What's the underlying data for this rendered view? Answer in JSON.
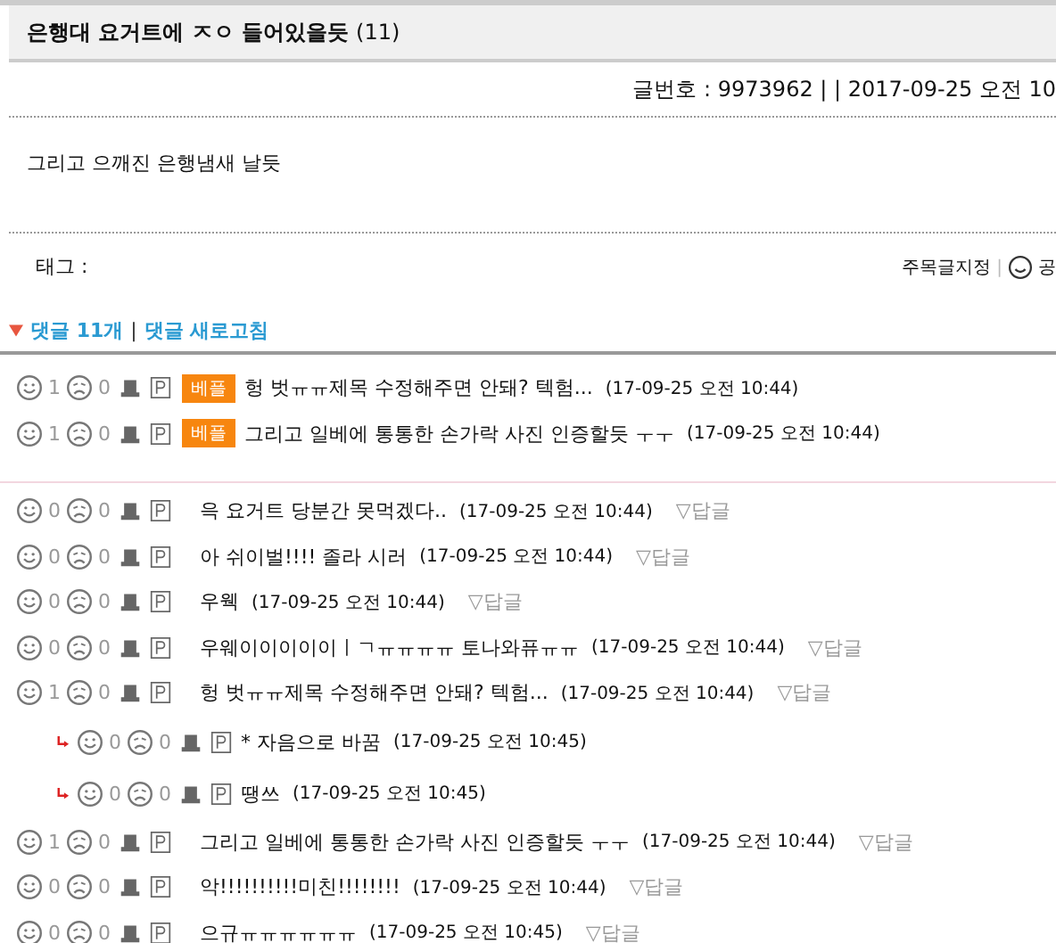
{
  "title": {
    "text": "은행대 요거트에 ㅈㅇ 들어있을듯",
    "count": "(11)"
  },
  "meta": "글번호 : 9973962 | | 2017-09-25 오전 10",
  "body": "그리고 으깨진 은행냄새 날듯",
  "tag_label": "태그 :",
  "actions": {
    "bookmark": "주목글지정",
    "separator": "|",
    "share": "공"
  },
  "comments_header": {
    "count_link": "댓글 11개",
    "separator": "|",
    "refresh_link": "댓글 새로고침"
  },
  "best_comments": [
    {
      "likes": "1",
      "dislikes": "0",
      "badge": "베플",
      "text": "헝 벗ㅠㅠ제목 수정해주면 안돼? 텍험...",
      "time": "(17-09-25 오전 10:44)"
    },
    {
      "likes": "1",
      "dislikes": "0",
      "badge": "베플",
      "text": "그리고 일베에 통통한 손가락 사진 인증할듯 ㅜㅜ",
      "time": "(17-09-25 오전 10:44)"
    }
  ],
  "comments": [
    {
      "likes": "0",
      "dislikes": "0",
      "text": "윽 요거트 당분간 못먹겠다..",
      "time": "(17-09-25 오전 10:44)",
      "reply_link": "▽답글"
    },
    {
      "likes": "0",
      "dislikes": "0",
      "text": "아 쉬이벌!!!! 졸라 시러",
      "time": "(17-09-25 오전 10:44)",
      "reply_link": "▽답글"
    },
    {
      "likes": "0",
      "dislikes": "0",
      "text": "우웩",
      "time": "(17-09-25 오전 10:44)",
      "reply_link": "▽답글"
    },
    {
      "likes": "0",
      "dislikes": "0",
      "text": "우웨이이이이이ㅣㄱㅠㅠㅠㅠ 토나와퓨ㅠㅠ",
      "time": "(17-09-25 오전 10:44)",
      "reply_link": "▽답글"
    },
    {
      "likes": "1",
      "dislikes": "0",
      "text": "헝 벗ㅠㅠ제목 수정해주면 안돼? 텍험...",
      "time": "(17-09-25 오전 10:44)",
      "reply_link": "▽답글",
      "children": [
        {
          "likes": "0",
          "dislikes": "0",
          "text": "* 자음으로 바꿈",
          "time": "(17-09-25 오전 10:45)"
        },
        {
          "likes": "0",
          "dislikes": "0",
          "text": "땡쓰",
          "time": "(17-09-25 오전 10:45)"
        }
      ]
    },
    {
      "likes": "1",
      "dislikes": "0",
      "text": "그리고 일베에 통통한 손가락 사진 인증할듯 ㅜㅜ",
      "time": "(17-09-25 오전 10:44)",
      "reply_link": "▽답글"
    },
    {
      "likes": "0",
      "dislikes": "0",
      "text": "악!!!!!!!!!!미친!!!!!!!!",
      "time": "(17-09-25 오전 10:44)",
      "reply_link": "▽답글"
    },
    {
      "likes": "0",
      "dislikes": "0",
      "text": "으규ㅠㅠㅠㅠㅠㅠ",
      "time": "(17-09-25 오전 10:45)",
      "reply_link": "▽답글"
    }
  ]
}
